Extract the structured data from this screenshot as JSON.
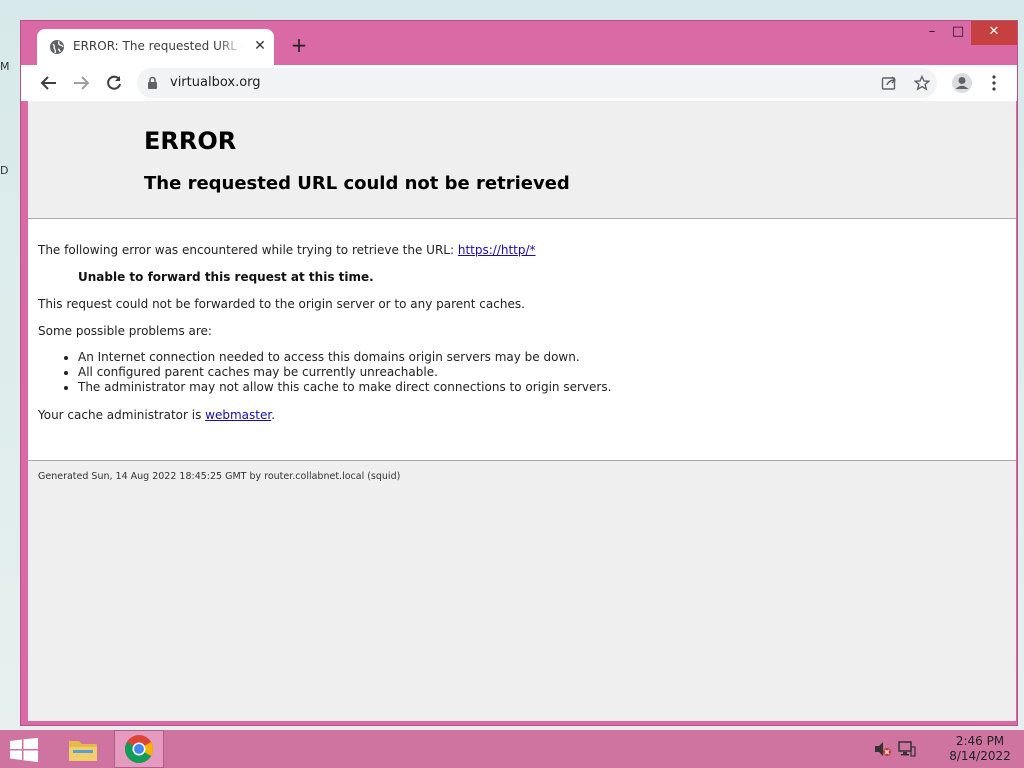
{
  "desktop": {
    "letters": [
      "M",
      "D"
    ]
  },
  "browser": {
    "tab": {
      "title": "ERROR: The requested URL could not be retrieved",
      "favicon": "globe-icon"
    },
    "address": "virtualbox.org",
    "controls": {
      "minimize": "–",
      "maximize": "□",
      "close": "✕"
    }
  },
  "page": {
    "heading": "ERROR",
    "subheading": "The requested URL could not be retrieved",
    "intro": "The following error was encountered while trying to retrieve the URL:",
    "url_link": "https://http/*",
    "error_message": "Unable to forward this request at this time.",
    "explanation": "This request could not be forwarded to the origin server or to any parent caches.",
    "problems_intro": "Some possible problems are:",
    "problems": [
      "An Internet connection needed to access this domains origin servers may be down.",
      "All configured parent caches may be currently unreachable.",
      "The administrator may not allow this cache to make direct connections to origin servers."
    ],
    "admin_prefix": "Your cache administrator is",
    "admin_link": "webmaster",
    "admin_suffix": ".",
    "footer": "Generated Sun, 14 Aug 2022 18:45:25 GMT by router.collabnet.local (squid)"
  },
  "taskbar": {
    "time": "2:46 PM",
    "date": "8/14/2022"
  },
  "colors": {
    "window_frame": "#d96aa6",
    "taskbar": "#cf74a0",
    "link": "#1a0dab",
    "close_button": "#c64040"
  }
}
